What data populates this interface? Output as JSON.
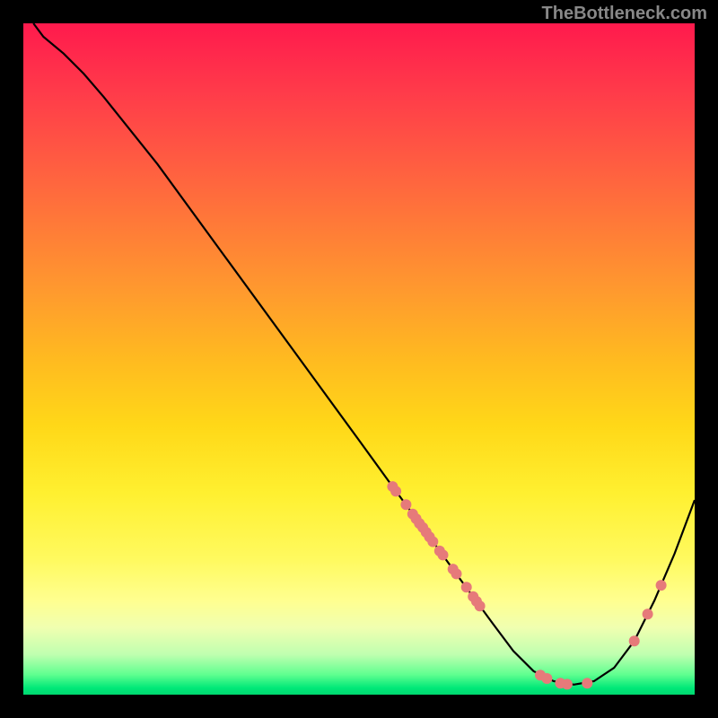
{
  "watermark": "TheBottleneck.com",
  "chart_data": {
    "type": "line",
    "title": "",
    "xlabel": "",
    "ylabel": "",
    "xlim": [
      0,
      100
    ],
    "ylim": [
      0,
      100
    ],
    "curve": [
      {
        "x": 1.5,
        "y": 100
      },
      {
        "x": 3,
        "y": 98
      },
      {
        "x": 6,
        "y": 95.5
      },
      {
        "x": 9,
        "y": 92.5
      },
      {
        "x": 12,
        "y": 89
      },
      {
        "x": 20,
        "y": 79
      },
      {
        "x": 30,
        "y": 65.3
      },
      {
        "x": 40,
        "y": 51.6
      },
      {
        "x": 50,
        "y": 37.9
      },
      {
        "x": 55,
        "y": 31
      },
      {
        "x": 60,
        "y": 24.2
      },
      {
        "x": 65,
        "y": 17.3
      },
      {
        "x": 70,
        "y": 10.5
      },
      {
        "x": 73,
        "y": 6.5
      },
      {
        "x": 76,
        "y": 3.5
      },
      {
        "x": 79,
        "y": 2
      },
      {
        "x": 82,
        "y": 1.5
      },
      {
        "x": 85,
        "y": 2
      },
      {
        "x": 88,
        "y": 4
      },
      {
        "x": 91,
        "y": 8
      },
      {
        "x": 94,
        "y": 14
      },
      {
        "x": 97,
        "y": 21
      },
      {
        "x": 100,
        "y": 29
      }
    ],
    "markers": [
      {
        "x": 55,
        "y": 31
      },
      {
        "x": 55.5,
        "y": 30.3
      },
      {
        "x": 57,
        "y": 28.3
      },
      {
        "x": 58,
        "y": 26.9
      },
      {
        "x": 58.5,
        "y": 26.2
      },
      {
        "x": 59,
        "y": 25.5
      },
      {
        "x": 59.5,
        "y": 24.9
      },
      {
        "x": 60,
        "y": 24.2
      },
      {
        "x": 60.5,
        "y": 23.5
      },
      {
        "x": 61,
        "y": 22.8
      },
      {
        "x": 62,
        "y": 21.4
      },
      {
        "x": 62.5,
        "y": 20.8
      },
      {
        "x": 64,
        "y": 18.7
      },
      {
        "x": 64.5,
        "y": 18.0
      },
      {
        "x": 66,
        "y": 16.0
      },
      {
        "x": 67,
        "y": 14.6
      },
      {
        "x": 67.5,
        "y": 13.9
      },
      {
        "x": 68,
        "y": 13.2
      },
      {
        "x": 77,
        "y": 2.9
      },
      {
        "x": 78,
        "y": 2.4
      },
      {
        "x": 80,
        "y": 1.7
      },
      {
        "x": 81,
        "y": 1.55
      },
      {
        "x": 84,
        "y": 1.7
      },
      {
        "x": 91,
        "y": 8
      },
      {
        "x": 93,
        "y": 12
      },
      {
        "x": 95,
        "y": 16.3
      }
    ],
    "marker_color": "#e67a7a",
    "gradient": {
      "top": "#ff1a4d",
      "mid": "#fff030",
      "bottom": "#00d870"
    }
  }
}
